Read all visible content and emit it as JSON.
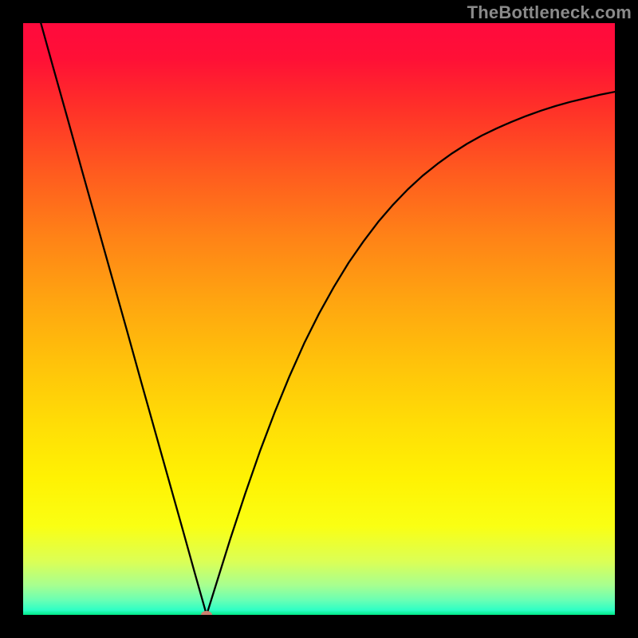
{
  "watermark": "TheBottleneck.com",
  "chart_data": {
    "type": "line",
    "title": "",
    "xlabel": "",
    "ylabel": "",
    "xlim": [
      0,
      100
    ],
    "ylim": [
      0,
      100
    ],
    "grid": false,
    "legend": false,
    "background_gradient": [
      {
        "pos": 0.0,
        "color": "#ff0a3d"
      },
      {
        "pos": 0.06,
        "color": "#ff1036"
      },
      {
        "pos": 0.14,
        "color": "#ff2f29"
      },
      {
        "pos": 0.25,
        "color": "#ff5a1f"
      },
      {
        "pos": 0.36,
        "color": "#ff8217"
      },
      {
        "pos": 0.47,
        "color": "#ffa510"
      },
      {
        "pos": 0.58,
        "color": "#ffc40a"
      },
      {
        "pos": 0.68,
        "color": "#ffde06"
      },
      {
        "pos": 0.77,
        "color": "#fff203"
      },
      {
        "pos": 0.85,
        "color": "#faff13"
      },
      {
        "pos": 0.91,
        "color": "#dbff56"
      },
      {
        "pos": 0.95,
        "color": "#a7ff90"
      },
      {
        "pos": 0.975,
        "color": "#6affb4"
      },
      {
        "pos": 0.992,
        "color": "#2effc5"
      },
      {
        "pos": 1.0,
        "color": "#00e887"
      }
    ],
    "minimum_marker": {
      "x": 31.0,
      "y": 0.0,
      "color": "#cc8070"
    },
    "series": [
      {
        "name": "curve",
        "color": "#000000",
        "x": [
          3.0,
          5.0,
          7.5,
          10.0,
          12.5,
          15.0,
          17.5,
          20.0,
          22.5,
          25.0,
          27.0,
          29.0,
          30.5,
          31.0,
          31.5,
          33.0,
          35.0,
          37.5,
          40.0,
          42.5,
          45.0,
          47.5,
          50.0,
          52.5,
          55.0,
          57.5,
          60.0,
          62.5,
          65.0,
          67.5,
          70.0,
          72.5,
          75.0,
          77.5,
          80.0,
          82.5,
          85.0,
          87.5,
          90.0,
          92.5,
          95.0,
          97.5,
          100.0
        ],
        "y": [
          100.0,
          92.8,
          83.9,
          74.9,
          66.0,
          57.1,
          48.2,
          39.2,
          30.3,
          21.4,
          14.3,
          7.1,
          1.8,
          0.0,
          1.6,
          6.4,
          12.8,
          20.4,
          27.6,
          34.2,
          40.3,
          45.9,
          50.9,
          55.4,
          59.5,
          63.1,
          66.4,
          69.3,
          71.9,
          74.2,
          76.2,
          78.0,
          79.6,
          81.0,
          82.2,
          83.3,
          84.3,
          85.2,
          86.0,
          86.7,
          87.3,
          87.9,
          88.4
        ]
      }
    ]
  }
}
